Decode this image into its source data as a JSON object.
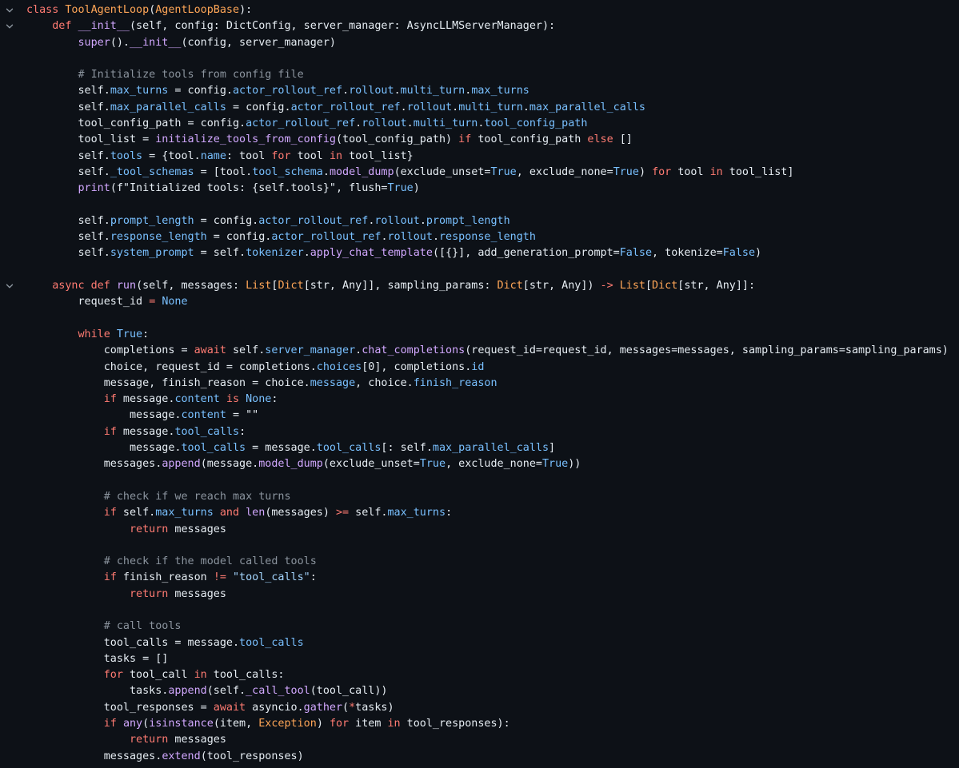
{
  "theme": {
    "background": "#0d1117",
    "text": "#e6edf3",
    "keyword": "#ff7b72",
    "class_name": "#ffa657",
    "function_name": "#d2a8ff",
    "attribute": "#79c0ff",
    "comment": "#8b949e",
    "string": "#a5d6ff",
    "fold_icon": "#8b949e"
  },
  "editor": {
    "language": "python",
    "fold_icon": "chevron-down-icon",
    "lines": [
      {
        "fold": true,
        "tokens": [
          [
            "kw",
            "class "
          ],
          [
            "cls",
            "ToolAgentLoop"
          ],
          [
            "p",
            "("
          ],
          [
            "cls",
            "AgentLoopBase"
          ],
          [
            "p",
            "):"
          ]
        ]
      },
      {
        "fold": true,
        "tokens": [
          [
            "p",
            "    "
          ],
          [
            "kw",
            "def "
          ],
          [
            "fn",
            "__init__"
          ],
          [
            "p",
            "(self, config: DictConfig, server_manager: AsyncLLMServerManager):"
          ]
        ]
      },
      {
        "tokens": [
          [
            "p",
            "        "
          ],
          [
            "fn",
            "super"
          ],
          [
            "p",
            "()."
          ],
          [
            "fn",
            "__init__"
          ],
          [
            "p",
            "(config, server_manager)"
          ]
        ]
      },
      {
        "tokens": []
      },
      {
        "tokens": [
          [
            "p",
            "        "
          ],
          [
            "cmt",
            "# Initialize tools from config file"
          ]
        ]
      },
      {
        "tokens": [
          [
            "p",
            "        self."
          ],
          [
            "attr",
            "max_turns"
          ],
          [
            "p",
            " = config."
          ],
          [
            "attr",
            "actor_rollout_ref"
          ],
          [
            "p",
            "."
          ],
          [
            "attr",
            "rollout"
          ],
          [
            "p",
            "."
          ],
          [
            "attr",
            "multi_turn"
          ],
          [
            "p",
            "."
          ],
          [
            "attr",
            "max_turns"
          ]
        ]
      },
      {
        "tokens": [
          [
            "p",
            "        self."
          ],
          [
            "attr",
            "max_parallel_calls"
          ],
          [
            "p",
            " = config."
          ],
          [
            "attr",
            "actor_rollout_ref"
          ],
          [
            "p",
            "."
          ],
          [
            "attr",
            "rollout"
          ],
          [
            "p",
            "."
          ],
          [
            "attr",
            "multi_turn"
          ],
          [
            "p",
            "."
          ],
          [
            "attr",
            "max_parallel_calls"
          ]
        ]
      },
      {
        "tokens": [
          [
            "p",
            "        tool_config_path = config."
          ],
          [
            "attr",
            "actor_rollout_ref"
          ],
          [
            "p",
            "."
          ],
          [
            "attr",
            "rollout"
          ],
          [
            "p",
            "."
          ],
          [
            "attr",
            "multi_turn"
          ],
          [
            "p",
            "."
          ],
          [
            "attr",
            "tool_config_path"
          ]
        ]
      },
      {
        "tokens": [
          [
            "p",
            "        tool_list = "
          ],
          [
            "fn",
            "initialize_tools_from_config"
          ],
          [
            "p",
            "(tool_config_path) "
          ],
          [
            "kw",
            "if"
          ],
          [
            "p",
            " tool_config_path "
          ],
          [
            "kw",
            "else"
          ],
          [
            "p",
            " []"
          ]
        ]
      },
      {
        "tokens": [
          [
            "p",
            "        self."
          ],
          [
            "attr",
            "tools"
          ],
          [
            "p",
            " = {tool."
          ],
          [
            "attr",
            "name"
          ],
          [
            "p",
            ": tool "
          ],
          [
            "kw",
            "for"
          ],
          [
            "p",
            " tool "
          ],
          [
            "kw",
            "in"
          ],
          [
            "p",
            " tool_list}"
          ]
        ]
      },
      {
        "tokens": [
          [
            "p",
            "        self."
          ],
          [
            "attr",
            "_tool_schemas"
          ],
          [
            "p",
            " = [tool."
          ],
          [
            "attr",
            "tool_schema"
          ],
          [
            "p",
            "."
          ],
          [
            "fn",
            "model_dump"
          ],
          [
            "p",
            "(exclude_unset="
          ],
          [
            "attr",
            "True"
          ],
          [
            "p",
            ", exclude_none="
          ],
          [
            "attr",
            "True"
          ],
          [
            "p",
            ") "
          ],
          [
            "kw",
            "for"
          ],
          [
            "p",
            " tool "
          ],
          [
            "kw",
            "in"
          ],
          [
            "p",
            " tool_list]"
          ]
        ]
      },
      {
        "tokens": [
          [
            "p",
            "        "
          ],
          [
            "fn",
            "print"
          ],
          [
            "p",
            "(f\"Initialized tools: {self.tools}\", flush="
          ],
          [
            "attr",
            "True"
          ],
          [
            "p",
            ")"
          ]
        ]
      },
      {
        "tokens": []
      },
      {
        "tokens": [
          [
            "p",
            "        self."
          ],
          [
            "attr",
            "prompt_length"
          ],
          [
            "p",
            " = config."
          ],
          [
            "attr",
            "actor_rollout_ref"
          ],
          [
            "p",
            "."
          ],
          [
            "attr",
            "rollout"
          ],
          [
            "p",
            "."
          ],
          [
            "attr",
            "prompt_length"
          ]
        ]
      },
      {
        "tokens": [
          [
            "p",
            "        self."
          ],
          [
            "attr",
            "response_length"
          ],
          [
            "p",
            " = config."
          ],
          [
            "attr",
            "actor_rollout_ref"
          ],
          [
            "p",
            "."
          ],
          [
            "attr",
            "rollout"
          ],
          [
            "p",
            "."
          ],
          [
            "attr",
            "response_length"
          ]
        ]
      },
      {
        "tokens": [
          [
            "p",
            "        self."
          ],
          [
            "attr",
            "system_prompt"
          ],
          [
            "p",
            " = self."
          ],
          [
            "attr",
            "tokenizer"
          ],
          [
            "p",
            "."
          ],
          [
            "fn",
            "apply_chat_template"
          ],
          [
            "p",
            "([{}], add_generation_prompt="
          ],
          [
            "attr",
            "False"
          ],
          [
            "p",
            ", tokenize="
          ],
          [
            "attr",
            "False"
          ],
          [
            "p",
            ")"
          ]
        ]
      },
      {
        "tokens": []
      },
      {
        "fold": true,
        "tokens": [
          [
            "p",
            "    "
          ],
          [
            "kw",
            "async def "
          ],
          [
            "fn",
            "run"
          ],
          [
            "p",
            "(self, messages: "
          ],
          [
            "cls",
            "List"
          ],
          [
            "p",
            "["
          ],
          [
            "cls",
            "Dict"
          ],
          [
            "p",
            "[str, Any]], sampling_params: "
          ],
          [
            "cls",
            "Dict"
          ],
          [
            "p",
            "[str, Any]) "
          ],
          [
            "kw",
            "->"
          ],
          [
            "p",
            " "
          ],
          [
            "cls",
            "List"
          ],
          [
            "p",
            "["
          ],
          [
            "cls",
            "Dict"
          ],
          [
            "p",
            "[str, Any]]:"
          ]
        ]
      },
      {
        "tokens": [
          [
            "p",
            "        request_id "
          ],
          [
            "kw",
            "="
          ],
          [
            "p",
            " "
          ],
          [
            "attr",
            "None"
          ]
        ]
      },
      {
        "tokens": []
      },
      {
        "tokens": [
          [
            "p",
            "        "
          ],
          [
            "kw",
            "while"
          ],
          [
            "p",
            " "
          ],
          [
            "attr",
            "True"
          ],
          [
            "p",
            ":"
          ]
        ]
      },
      {
        "tokens": [
          [
            "p",
            "            completions = "
          ],
          [
            "kw",
            "await"
          ],
          [
            "p",
            " self."
          ],
          [
            "attr",
            "server_manager"
          ],
          [
            "p",
            "."
          ],
          [
            "fn",
            "chat_completions"
          ],
          [
            "p",
            "(request_id=request_id, messages=messages, sampling_params=sampling_params)"
          ]
        ]
      },
      {
        "tokens": [
          [
            "p",
            "            choice, request_id = completions."
          ],
          [
            "attr",
            "choices"
          ],
          [
            "p",
            "[0], completions."
          ],
          [
            "attr",
            "id"
          ]
        ]
      },
      {
        "tokens": [
          [
            "p",
            "            message, finish_reason = choice."
          ],
          [
            "attr",
            "message"
          ],
          [
            "p",
            ", choice."
          ],
          [
            "attr",
            "finish_reason"
          ]
        ]
      },
      {
        "tokens": [
          [
            "p",
            "            "
          ],
          [
            "kw",
            "if"
          ],
          [
            "p",
            " message."
          ],
          [
            "attr",
            "content"
          ],
          [
            "p",
            " "
          ],
          [
            "kw",
            "is"
          ],
          [
            "p",
            " "
          ],
          [
            "attr",
            "None"
          ],
          [
            "p",
            ":"
          ]
        ]
      },
      {
        "tokens": [
          [
            "p",
            "                message."
          ],
          [
            "attr",
            "content"
          ],
          [
            "p",
            " = \"\""
          ]
        ]
      },
      {
        "tokens": [
          [
            "p",
            "            "
          ],
          [
            "kw",
            "if"
          ],
          [
            "p",
            " message."
          ],
          [
            "attr",
            "tool_calls"
          ],
          [
            "p",
            ":"
          ]
        ]
      },
      {
        "tokens": [
          [
            "p",
            "                message."
          ],
          [
            "attr",
            "tool_calls"
          ],
          [
            "p",
            " = message."
          ],
          [
            "attr",
            "tool_calls"
          ],
          [
            "p",
            "[: self."
          ],
          [
            "attr",
            "max_parallel_calls"
          ],
          [
            "p",
            "]"
          ]
        ]
      },
      {
        "tokens": [
          [
            "p",
            "            messages."
          ],
          [
            "fn",
            "append"
          ],
          [
            "p",
            "(message."
          ],
          [
            "fn",
            "model_dump"
          ],
          [
            "p",
            "(exclude_unset="
          ],
          [
            "attr",
            "True"
          ],
          [
            "p",
            ", exclude_none="
          ],
          [
            "attr",
            "True"
          ],
          [
            "p",
            "))"
          ]
        ]
      },
      {
        "tokens": []
      },
      {
        "tokens": [
          [
            "p",
            "            "
          ],
          [
            "cmt",
            "# check if we reach max turns"
          ]
        ]
      },
      {
        "tokens": [
          [
            "p",
            "            "
          ],
          [
            "kw",
            "if"
          ],
          [
            "p",
            " self."
          ],
          [
            "attr",
            "max_turns"
          ],
          [
            "p",
            " "
          ],
          [
            "kw",
            "and"
          ],
          [
            "p",
            " "
          ],
          [
            "fn",
            "len"
          ],
          [
            "p",
            "(messages) "
          ],
          [
            "kw",
            ">="
          ],
          [
            "p",
            " self."
          ],
          [
            "attr",
            "max_turns"
          ],
          [
            "p",
            ":"
          ]
        ]
      },
      {
        "tokens": [
          [
            "p",
            "                "
          ],
          [
            "kw",
            "return"
          ],
          [
            "p",
            " messages"
          ]
        ]
      },
      {
        "tokens": []
      },
      {
        "tokens": [
          [
            "p",
            "            "
          ],
          [
            "cmt",
            "# check if the model called tools"
          ]
        ]
      },
      {
        "tokens": [
          [
            "p",
            "            "
          ],
          [
            "kw",
            "if"
          ],
          [
            "p",
            " finish_reason "
          ],
          [
            "kw",
            "!="
          ],
          [
            "p",
            " "
          ],
          [
            "str",
            "\"tool_calls\""
          ],
          [
            "p",
            ":"
          ]
        ]
      },
      {
        "tokens": [
          [
            "p",
            "                "
          ],
          [
            "kw",
            "return"
          ],
          [
            "p",
            " messages"
          ]
        ]
      },
      {
        "tokens": []
      },
      {
        "tokens": [
          [
            "p",
            "            "
          ],
          [
            "cmt",
            "# call tools"
          ]
        ]
      },
      {
        "tokens": [
          [
            "p",
            "            tool_calls = message."
          ],
          [
            "attr",
            "tool_calls"
          ]
        ]
      },
      {
        "tokens": [
          [
            "p",
            "            tasks = []"
          ]
        ]
      },
      {
        "tokens": [
          [
            "p",
            "            "
          ],
          [
            "kw",
            "for"
          ],
          [
            "p",
            " tool_call "
          ],
          [
            "kw",
            "in"
          ],
          [
            "p",
            " tool_calls:"
          ]
        ]
      },
      {
        "tokens": [
          [
            "p",
            "                tasks."
          ],
          [
            "fn",
            "append"
          ],
          [
            "p",
            "(self."
          ],
          [
            "fn",
            "_call_tool"
          ],
          [
            "p",
            "(tool_call))"
          ]
        ]
      },
      {
        "tokens": [
          [
            "p",
            "            tool_responses = "
          ],
          [
            "kw",
            "await"
          ],
          [
            "p",
            " asyncio."
          ],
          [
            "fn",
            "gather"
          ],
          [
            "p",
            "("
          ],
          [
            "kw",
            "*"
          ],
          [
            "p",
            "tasks)"
          ]
        ]
      },
      {
        "tokens": [
          [
            "p",
            "            "
          ],
          [
            "kw",
            "if"
          ],
          [
            "p",
            " "
          ],
          [
            "fn",
            "any"
          ],
          [
            "p",
            "("
          ],
          [
            "fn",
            "isinstance"
          ],
          [
            "p",
            "(item, "
          ],
          [
            "cls",
            "Exception"
          ],
          [
            "p",
            ") "
          ],
          [
            "kw",
            "for"
          ],
          [
            "p",
            " item "
          ],
          [
            "kw",
            "in"
          ],
          [
            "p",
            " tool_responses):"
          ]
        ]
      },
      {
        "tokens": [
          [
            "p",
            "                "
          ],
          [
            "kw",
            "return"
          ],
          [
            "p",
            " messages"
          ]
        ]
      },
      {
        "tokens": [
          [
            "p",
            "            messages."
          ],
          [
            "fn",
            "extend"
          ],
          [
            "p",
            "(tool_responses)"
          ]
        ]
      }
    ]
  }
}
